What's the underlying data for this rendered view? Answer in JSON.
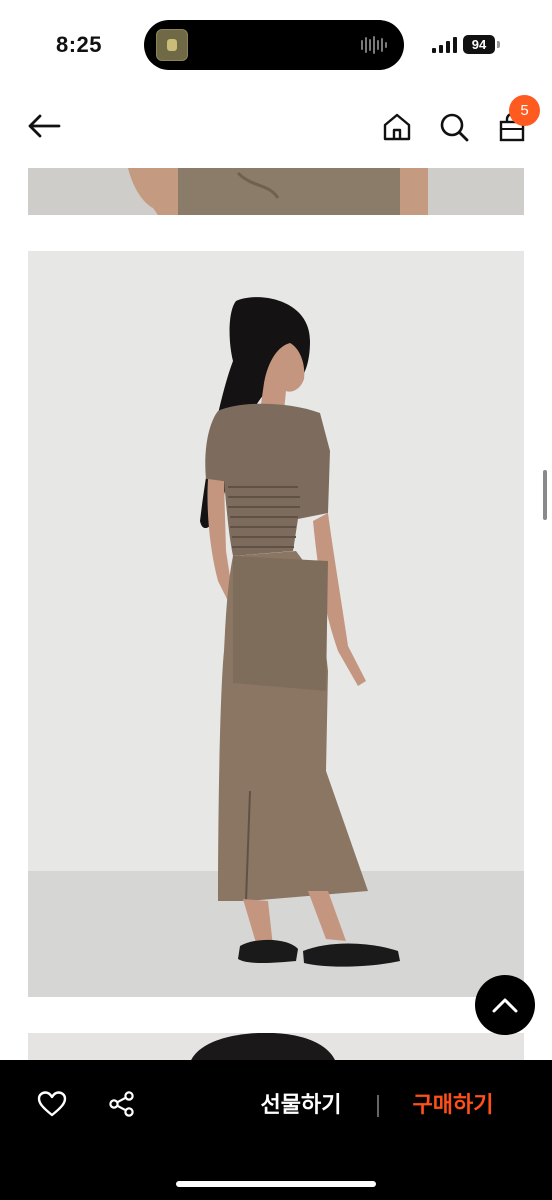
{
  "status_bar": {
    "time": "8:25",
    "battery": "94"
  },
  "nav": {
    "cart_count": "5"
  },
  "bottom_bar": {
    "gift_label": "선물하기",
    "buy_label": "구매하기"
  },
  "colors": {
    "accent": "#ff5a1f",
    "buy_text": "#ff4f1a",
    "bar_bg": "#000000"
  },
  "icons": {
    "back": "arrow-left-icon",
    "home": "home-icon",
    "search": "search-icon",
    "cart": "shopping-bag-icon",
    "like": "heart-icon",
    "share": "share-icon",
    "scroll_top": "chevron-up-icon"
  }
}
